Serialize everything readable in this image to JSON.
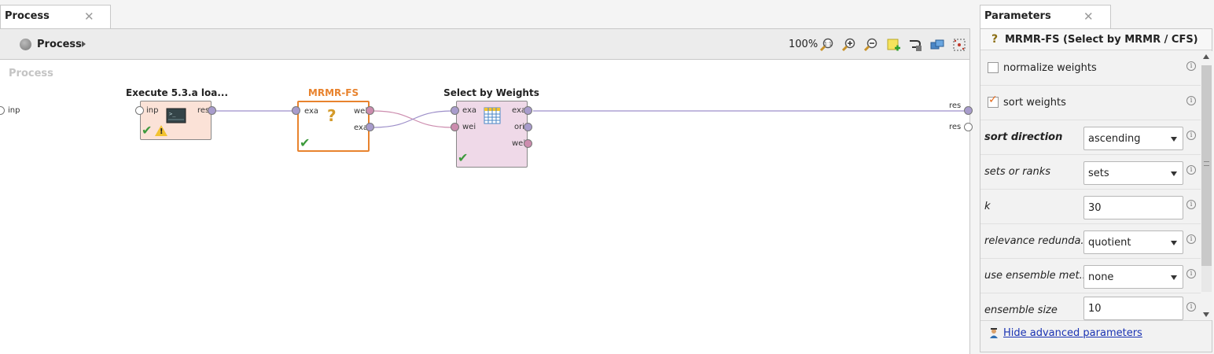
{
  "process_tab": {
    "label": "Process"
  },
  "toolbar": {
    "breadcrumb": "Process",
    "zoom": "100%"
  },
  "canvas": {
    "title": "Process",
    "input_port": "inp",
    "result_ports": [
      "res",
      "res"
    ]
  },
  "operators": {
    "exec": {
      "title": "Execute 5.3.a loa...",
      "in_ports": [
        "inp"
      ],
      "out_ports": [
        "res"
      ]
    },
    "mrmr": {
      "title": "MRMR-FS",
      "in_ports": [
        "exa"
      ],
      "out_ports": [
        "wei",
        "exa"
      ]
    },
    "select": {
      "title": "Select by Weights",
      "in_ports": [
        "exa",
        "wei"
      ],
      "out_ports": [
        "exa",
        "ori",
        "wei"
      ]
    }
  },
  "params_tab": {
    "label": "Parameters"
  },
  "params": {
    "header": "MRMR-FS (Select by MRMR / CFS)",
    "normalize_weights": {
      "label": "normalize weights",
      "checked": false
    },
    "sort_weights": {
      "label": "sort weights",
      "checked": true
    },
    "sort_direction": {
      "label": "sort direction",
      "value": "ascending"
    },
    "sets_or_ranks": {
      "label": "sets or ranks",
      "value": "sets"
    },
    "k": {
      "label": "k",
      "value": "30"
    },
    "relevance_redundancy": {
      "label": "relevance redunda...",
      "value": "quotient"
    },
    "use_ensemble": {
      "label": "use ensemble met...",
      "value": "none"
    },
    "ensemble_size": {
      "label": "ensemble size",
      "value": "10"
    },
    "hide_advanced": "Hide advanced parameters"
  },
  "colors": {
    "accent_orange": "#e8832e",
    "link": "#1a33b3",
    "check_green": "#3d9a3d"
  }
}
